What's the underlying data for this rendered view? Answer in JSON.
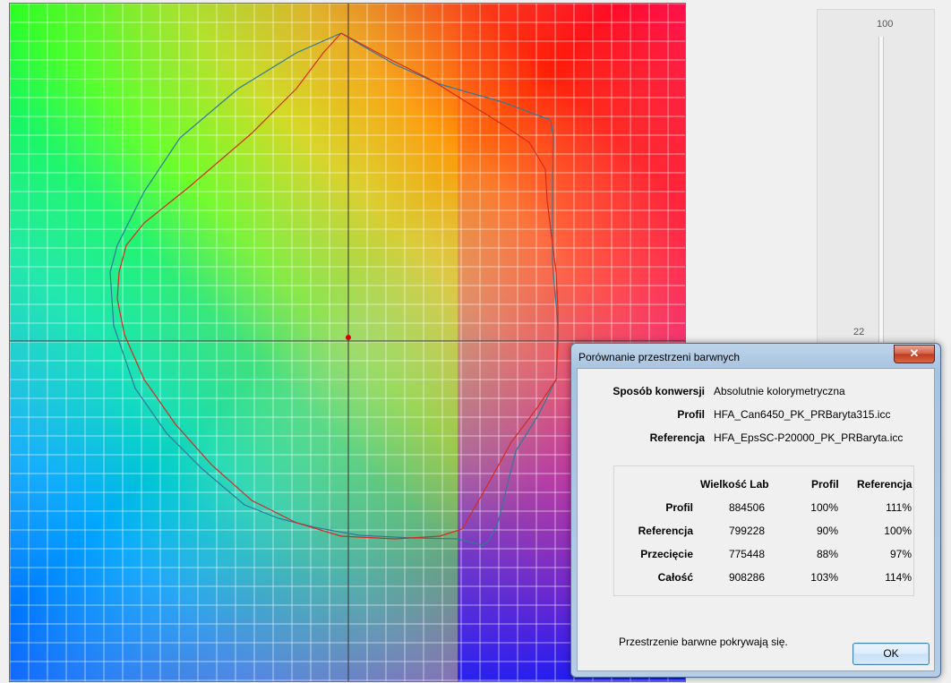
{
  "plot": {
    "gamut_profile_color": "#d62a1e",
    "gamut_reference_color": "#2e7a9a",
    "white_point_color": "#d80000"
  },
  "slider": {
    "max_label": "100",
    "value_label": "22"
  },
  "dialog": {
    "title": "Porównanie przestrzeni barwnych",
    "close_label": "✕",
    "method_label": "Sposób konwersji",
    "method_value": "Absolutnie kolorymetryczna",
    "profile_label": "Profil",
    "profile_value": "HFA_Can6450_PK_PRBaryta315.icc",
    "reference_label": "Referencja",
    "reference_value": "HFA_EpsSC-P20000_PK_PRBaryta.icc",
    "table": {
      "headers": [
        "Wielkość Lab",
        "Profil",
        "Referencja"
      ],
      "rows": [
        {
          "label": "Profil",
          "lab": "884506",
          "profil": "100%",
          "ref": "111%"
        },
        {
          "label": "Referencja",
          "lab": "799228",
          "profil": "90%",
          "ref": "100%"
        },
        {
          "label": "Przecięcie",
          "lab": "775448",
          "profil": "88%",
          "ref": "97%"
        },
        {
          "label": "Całość",
          "lab": "908286",
          "profil": "103%",
          "ref": "114%"
        }
      ]
    },
    "status": "Przestrzenie barwne pokrywają się.",
    "ok_label": "OK"
  }
}
